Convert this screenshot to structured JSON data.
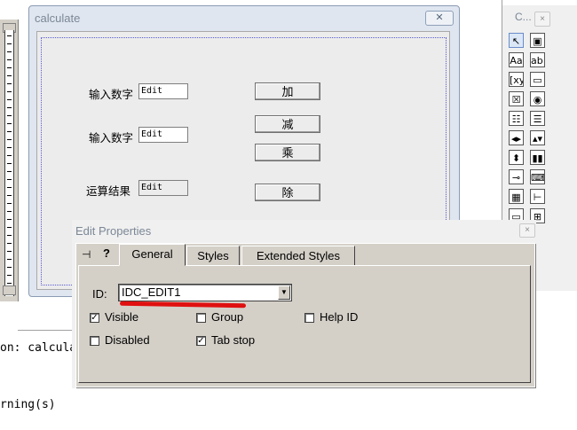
{
  "dialog": {
    "title": "calculate",
    "close_glyph": "✕",
    "rows": [
      {
        "label": "输入数字",
        "edit": "Edit"
      },
      {
        "label": "输入数字",
        "edit": "Edit"
      },
      {
        "label": "运算结果",
        "edit": "Edit"
      }
    ],
    "buttons": {
      "add": "加",
      "subtract": "减",
      "multiply": "乘",
      "divide": "除"
    }
  },
  "toolbox": {
    "title": "C...",
    "close_glyph": "×",
    "tools": [
      {
        "icon": "pointer-icon",
        "glyph": "↖"
      },
      {
        "icon": "picture-icon",
        "glyph": "▣"
      },
      {
        "icon": "static-text-icon",
        "glyph": "Aa"
      },
      {
        "icon": "edit-box-icon",
        "glyph": "ab|"
      },
      {
        "icon": "group-box-icon",
        "glyph": "[xy]"
      },
      {
        "icon": "button-icon",
        "glyph": "▭"
      },
      {
        "icon": "checkbox-icon",
        "glyph": "☒"
      },
      {
        "icon": "radio-icon",
        "glyph": "◉"
      },
      {
        "icon": "combo-box-icon",
        "glyph": "☷"
      },
      {
        "icon": "list-box-icon",
        "glyph": "☰"
      },
      {
        "icon": "hscroll-icon",
        "glyph": "◂▸"
      },
      {
        "icon": "vscroll-icon",
        "glyph": "▴▾"
      },
      {
        "icon": "spin-icon",
        "glyph": "⬍"
      },
      {
        "icon": "progress-icon",
        "glyph": "▮▮"
      },
      {
        "icon": "slider-icon",
        "glyph": "⊸"
      },
      {
        "icon": "hotkey-icon",
        "glyph": "⌨"
      },
      {
        "icon": "list-control-icon",
        "glyph": "▦"
      },
      {
        "icon": "tree-control-icon",
        "glyph": "⊢"
      },
      {
        "icon": "tab-control-icon",
        "glyph": "▭"
      },
      {
        "icon": "animate-icon",
        "glyph": "⊞"
      }
    ]
  },
  "output": {
    "line1": "on: calcula",
    "line2": "rning(s)"
  },
  "properties": {
    "title": "Edit Properties",
    "close_glyph": "×",
    "pin_glyph": "⊣",
    "help_glyph": "?",
    "tabs": [
      "General",
      "Styles",
      "Extended Styles"
    ],
    "id_label": "ID:",
    "id_value": "IDC_EDIT1",
    "dropdown_glyph": "▼",
    "checkboxes": [
      {
        "label": "Visible",
        "checked": true,
        "mark": "✓"
      },
      {
        "label": "Group",
        "checked": false,
        "mark": ""
      },
      {
        "label": "Help ID",
        "checked": false,
        "mark": ""
      },
      {
        "label": "Disabled",
        "checked": false,
        "mark": ""
      },
      {
        "label": "Tab stop",
        "checked": true,
        "mark": "✓"
      }
    ]
  },
  "colors": {
    "annotation": "#e01010",
    "selection_border": "#5a5ad0"
  }
}
